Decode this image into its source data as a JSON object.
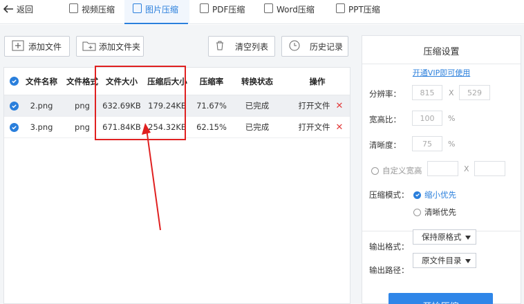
{
  "topbar": {
    "back_label": "返回",
    "tabs": [
      {
        "label": "视频压缩",
        "active": false
      },
      {
        "label": "图片压缩",
        "active": true
      },
      {
        "label": "PDF压缩",
        "active": false
      },
      {
        "label": "Word压缩",
        "active": false
      },
      {
        "label": "PPT压缩",
        "active": false
      }
    ]
  },
  "toolbar": {
    "add_file": "添加文件",
    "add_folder": "添加文件夹",
    "clear_list": "清空列表",
    "history": "历史记录"
  },
  "table": {
    "headers": [
      "文件名称",
      "文件格式",
      "文件大小",
      "压缩后大小",
      "压缩率",
      "转换状态",
      "操作"
    ],
    "rows": [
      {
        "name": "2.png",
        "format": "png",
        "size": "632.69KB",
        "compressed": "179.24KB",
        "ratio": "71.67%",
        "status": "已完成",
        "action": "打开文件",
        "checked": true
      },
      {
        "name": "3.png",
        "format": "png",
        "size": "671.84KB",
        "compressed": "254.32KB",
        "ratio": "62.15%",
        "status": "已完成",
        "action": "打开文件",
        "checked": true
      }
    ]
  },
  "settings": {
    "title": "压缩设置",
    "vip_link": "开通VIP即可使用",
    "resolution_label": "分辨率：",
    "res_width": "815",
    "res_x": "X",
    "res_height": "529",
    "aspect_label": "宽高比：",
    "aspect_value": "100",
    "aspect_unit": "%",
    "clarity_label": "清晰度：",
    "clarity_value": "75",
    "clarity_unit": "%",
    "custom_label": "自定义宽高",
    "custom_x": "X",
    "mode_label": "压缩模式：",
    "mode_options": [
      "缩小优先",
      "清晰优先"
    ],
    "mode_selected": "缩小优先",
    "format_label": "输出格式：",
    "format_value": "保持原格式",
    "path_label": "输出路径：",
    "path_value": "原文件目录",
    "start_button": "开始压缩"
  },
  "colors": {
    "accent": "#2a7fdc",
    "highlight": "#e02020",
    "button": "#2f86e8"
  }
}
